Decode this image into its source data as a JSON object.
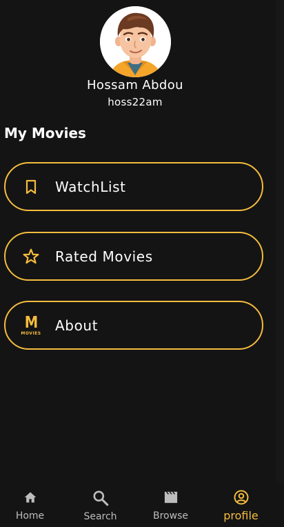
{
  "profile": {
    "name": "Hossam Abdou",
    "username": "hoss22am"
  },
  "section_title": "My Movies",
  "menu": [
    {
      "label": "WatchList",
      "icon": "bookmark-icon"
    },
    {
      "label": "Rated Movies",
      "icon": "star-outline-icon"
    },
    {
      "label": "About",
      "icon": "movies-logo-icon",
      "logo_letter": "M",
      "logo_text": "MOVIES"
    }
  ],
  "bottom_nav": [
    {
      "label": "Home",
      "icon": "home-icon",
      "active": false
    },
    {
      "label": "Search",
      "icon": "search-icon",
      "active": false
    },
    {
      "label": "Browse",
      "icon": "movie-icon",
      "active": false
    },
    {
      "label": "profile",
      "icon": "account-circle-icon",
      "active": true
    }
  ],
  "colors": {
    "background": "#141414",
    "accent": "#f6bd3e",
    "text": "#ffffff",
    "nav_inactive": "#bdbdbd"
  }
}
